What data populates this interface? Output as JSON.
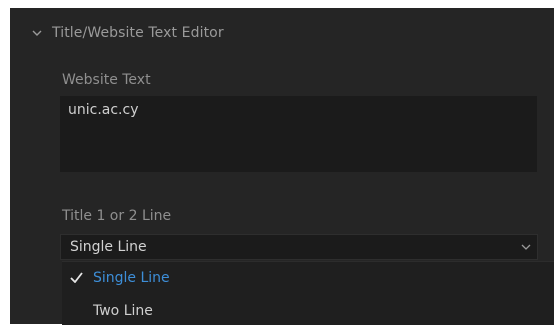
{
  "section": {
    "title": "Title/Website Text Editor",
    "expanded": true,
    "icon": "chevron-down-icon"
  },
  "website_text": {
    "label": "Website Text",
    "value": "unic.ac.cy"
  },
  "title_lines": {
    "label": "Title 1 or 2 Line",
    "selected": "Single Line",
    "caret_icon": "chevron-down-icon",
    "options": [
      {
        "label": "Single Line",
        "checked": true
      },
      {
        "label": "Two Line",
        "checked": false
      }
    ]
  },
  "colors": {
    "panel_bg": "#252525",
    "field_bg": "#1b1b1b",
    "selected_option": "#3d8ed8",
    "text": "#cfcfcf"
  }
}
